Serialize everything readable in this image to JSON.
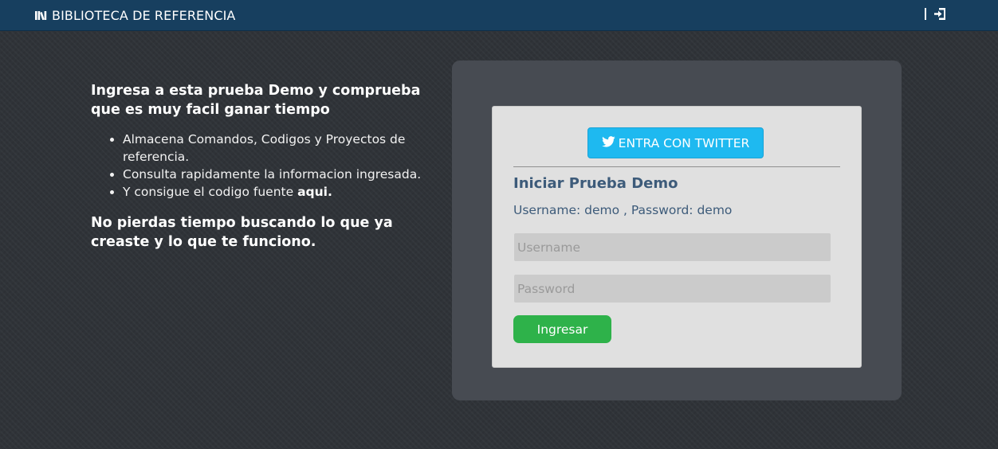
{
  "header": {
    "brand_icon": "library-books-icon",
    "brand_text": "BIBLIOTECA DE REFERENCIA",
    "logout_icon": "sign-in-icon"
  },
  "intro": {
    "heading": "Ingresa a esta prueba Demo y comprueba que es muy facil ganar tiempo",
    "features": [
      {
        "text": "Almacena Comandos, Codigos y Proyectos de referencia."
      },
      {
        "text": "Consulta rapidamente la informacion ingresada."
      },
      {
        "text": "Y consigue el codigo fuente ",
        "link": "aqui."
      }
    ],
    "closing": "No pierdas tiempo buscando lo que ya creaste y lo que te funciono."
  },
  "login": {
    "twitter_label": "ENTRA CON TWITTER",
    "twitter_icon": "twitter-icon",
    "title": "Iniciar Prueba Demo",
    "credentials_hint": "Username: demo , Password: demo",
    "username_placeholder": "Username",
    "username_value": "",
    "password_placeholder": "Password",
    "password_value": "",
    "submit_label": "Ingresar"
  },
  "colors": {
    "header_bg": "#173f5f",
    "twitter_blue": "#1eb9f0",
    "submit_green": "#2eb24a",
    "form_text": "#3d5b7a"
  }
}
